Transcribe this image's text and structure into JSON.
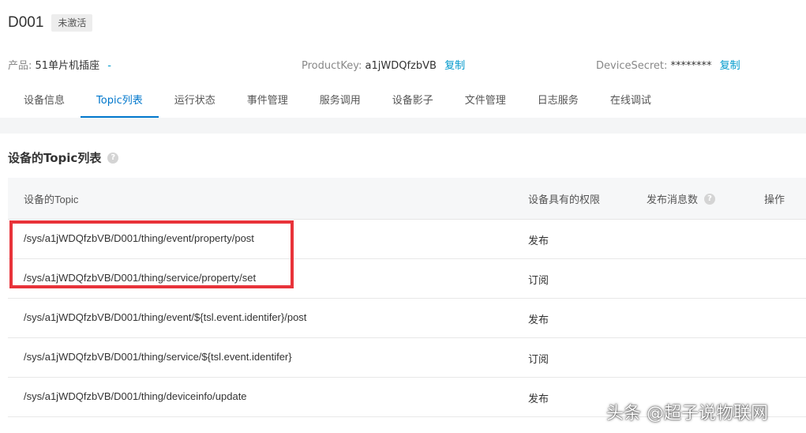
{
  "device": {
    "name": "D001",
    "status": "未激活"
  },
  "meta": {
    "product_label": "产品:",
    "product_value": "51单片机插座",
    "product_link": "-",
    "productkey_label": "ProductKey:",
    "productkey_value": "a1jWDQfzbVB",
    "productkey_copy": "复制",
    "secret_label": "DeviceSecret:",
    "secret_value": "********",
    "secret_copy": "复制"
  },
  "tabs": [
    {
      "label": "设备信息"
    },
    {
      "label": "Topic列表"
    },
    {
      "label": "运行状态"
    },
    {
      "label": "事件管理"
    },
    {
      "label": "服务调用"
    },
    {
      "label": "设备影子"
    },
    {
      "label": "文件管理"
    },
    {
      "label": "日志服务"
    },
    {
      "label": "在线调试"
    }
  ],
  "active_tab": "Topic列表",
  "section": {
    "title": "设备的Topic列表",
    "help_icon": "?"
  },
  "table": {
    "headers": {
      "topic": "设备的Topic",
      "permission": "设备具有的权限",
      "count": "发布消息数",
      "ops": "操作"
    },
    "rows": [
      {
        "topic": "/sys/a1jWDQfzbVB/D001/thing/event/property/post",
        "permission": "发布"
      },
      {
        "topic": "/sys/a1jWDQfzbVB/D001/thing/service/property/set",
        "permission": "订阅"
      },
      {
        "topic": "/sys/a1jWDQfzbVB/D001/thing/event/${tsl.event.identifer}/post",
        "permission": "发布"
      },
      {
        "topic": "/sys/a1jWDQfzbVB/D001/thing/service/${tsl.event.identifer}",
        "permission": "订阅"
      },
      {
        "topic": "/sys/a1jWDQfzbVB/D001/thing/deviceinfo/update",
        "permission": "发布"
      }
    ]
  },
  "watermark": "头条 @超子说物联网",
  "colors": {
    "accent": "#0077cc",
    "link": "#0099cc",
    "highlight": "#e8333a"
  }
}
